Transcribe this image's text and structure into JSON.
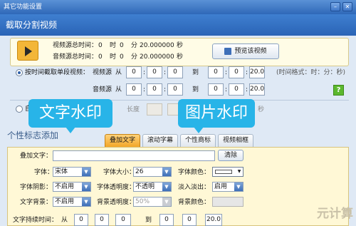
{
  "window": {
    "title": "其它功能设置"
  },
  "header": {
    "title": "截取分割视频"
  },
  "video_info": {
    "video_length_label": "视频源总时间：",
    "audio_length_label": "音频源总时间：",
    "zero": "0",
    "hour_unit": "时",
    "minute_unit": "分",
    "second_unit": "秒",
    "seconds_value": "20.000000",
    "preview_button": "预览该视频"
  },
  "time_segment": {
    "radio_label": "按时间截取单段视频：",
    "video_source_label": "视频源",
    "audio_source_label": "音频源",
    "from_label": "从",
    "to_label": "到",
    "colon": ":",
    "zero": "0",
    "end_seconds": "20.0",
    "format_hint": "(时间格式：时：分：秒)",
    "help": "?"
  },
  "split_row": {
    "partial_label": "自",
    "length_label": "长度",
    "seconds_label": "秒"
  },
  "overlays": {
    "text_watermark": "文字水印",
    "image_watermark": "图片水印"
  },
  "personal_section": {
    "title": "个性标志添加"
  },
  "tabs": [
    "叠加文字",
    "滚动字幕",
    "个性商标",
    "视频相框"
  ],
  "overlay_text": {
    "text_label": "叠加文字：",
    "text_value": "",
    "clear_button": "清除",
    "font_label": "字体：",
    "font_value": "宋体",
    "font_size_label": "字体大小：",
    "font_size_value": "26",
    "font_color_label": "字体颜色：",
    "font_color_value": "#ffffff",
    "shadow_label": "字体阴影：",
    "shadow_value": "不启用",
    "transparency_label": "字体透明度：",
    "transparency_value": "不透明",
    "fade_label": "淡入淡出：",
    "fade_value": "启用",
    "bg_label": "文字背景：",
    "bg_value": "不启用",
    "bg_transparency_label": "背景透明度：",
    "bg_transparency_value": "50%",
    "bg_color_label": "背景颜色：",
    "duration_label": "文字持续时间：",
    "from_label": "从",
    "to_label": "到",
    "zero": "0",
    "end_seconds": "20.0"
  },
  "watermark": {
    "text": "元计算"
  },
  "colors": {
    "header": "#2a64b6",
    "accent_bubble": "#28b4e8",
    "tab_active": "#f2a628",
    "panel_bg": "#fffce6"
  }
}
